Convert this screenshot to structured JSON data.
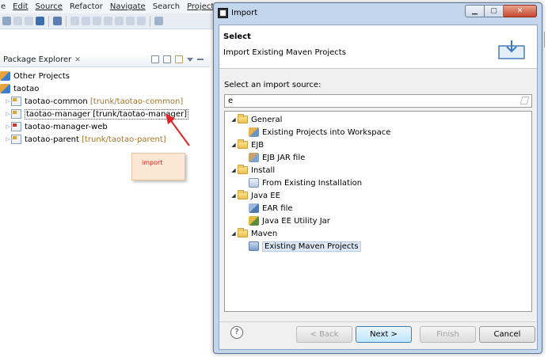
{
  "menubar": {
    "items": [
      "e",
      "Edit",
      "Source",
      "Refactor",
      "Navigate",
      "Search",
      "Project"
    ]
  },
  "package_explorer": {
    "title": "Package Explorer",
    "close_glyph": "✕",
    "tree": [
      {
        "label": "Other Projects",
        "svn": ""
      },
      {
        "label": "taotao",
        "svn": ""
      },
      {
        "label": "taotao-common",
        "svn": "[trunk/taotao-common]"
      },
      {
        "label": "taotao-manager",
        "svn": "[trunk/taotao-manager]"
      },
      {
        "label": "taotao-manager-web",
        "svn": ""
      },
      {
        "label": "taotao-parent",
        "svn": "[trunk/taotao-parent]"
      }
    ]
  },
  "annotation": {
    "note_text": "import",
    "arrow_color": "#e0262a"
  },
  "dialog": {
    "title": "Import",
    "banner_heading": "Select",
    "banner_description": "Import Existing Maven Projects",
    "source_label": "Select an import source:",
    "filter_value": "e",
    "tree": [
      {
        "label": "General",
        "type": "folder"
      },
      {
        "label": "Existing Projects into Workspace",
        "type": "item"
      },
      {
        "label": "EJB",
        "type": "folder"
      },
      {
        "label": "EJB JAR file",
        "type": "item"
      },
      {
        "label": "Install",
        "type": "folder"
      },
      {
        "label": "From Existing Installation",
        "type": "item"
      },
      {
        "label": "Java EE",
        "type": "folder"
      },
      {
        "label": "EAR file",
        "type": "item"
      },
      {
        "label": "Java EE Utility Jar",
        "type": "item"
      },
      {
        "label": "Maven",
        "type": "folder"
      },
      {
        "label": "Existing Maven Projects",
        "type": "item",
        "selected": true
      }
    ],
    "buttons": {
      "help": "?",
      "back": "< Back",
      "next": "Next >",
      "finish": "Finish",
      "cancel": "Cancel"
    }
  },
  "colors": {
    "dialog_frame": "#c4d6ec",
    "selection": "#dde7f5",
    "svn_decoration": "#a0762e"
  }
}
